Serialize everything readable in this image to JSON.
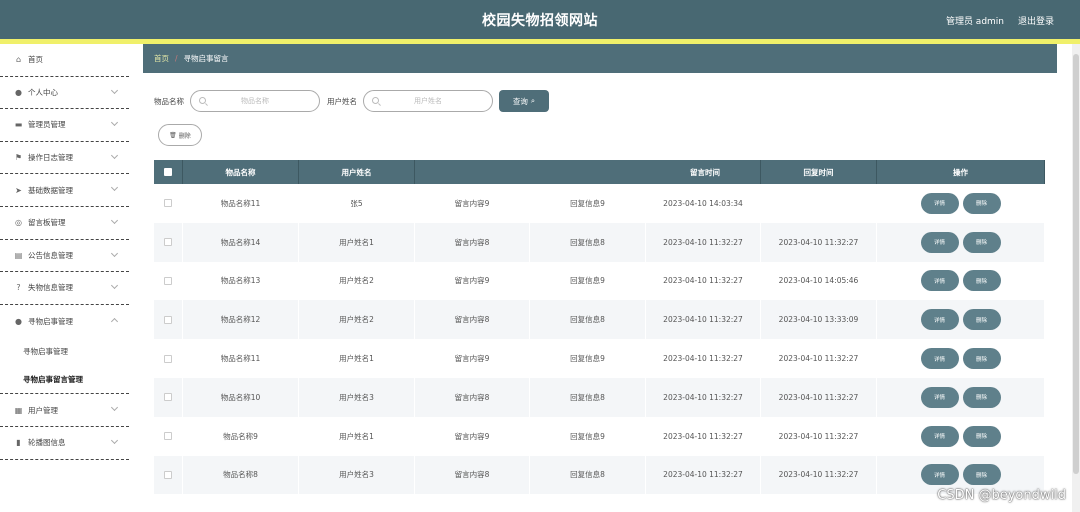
{
  "header": {
    "title": "校园失物招领网站",
    "admin": "管理员 admin",
    "logout": "退出登录"
  },
  "breadcrumb": {
    "home": "首页",
    "sep": "/",
    "current": "寻物启事留言"
  },
  "search": {
    "item_label": "物品名称",
    "item_placeholder": "物品名称",
    "user_label": "用户姓名",
    "user_placeholder": "用户姓名",
    "query_label": "查询"
  },
  "actions": {
    "delete": "删除"
  },
  "sidebar": {
    "items": [
      {
        "label": "首页",
        "icon": "home-icon"
      },
      {
        "label": "个人中心",
        "icon": "user-icon"
      },
      {
        "label": "管理员管理",
        "icon": "monitor-icon"
      },
      {
        "label": "操作日志管理",
        "icon": "flag-icon"
      },
      {
        "label": "基础数据管理",
        "icon": "send-icon"
      },
      {
        "label": "留言板管理",
        "icon": "compass-icon"
      },
      {
        "label": "公告信息管理",
        "icon": "printer-icon"
      },
      {
        "label": "失物信息管理",
        "icon": "question-icon"
      },
      {
        "label": "寻物启事管理",
        "icon": "location-icon"
      },
      {
        "label": "用户管理",
        "icon": "grid-icon"
      },
      {
        "label": "轮播图信息",
        "icon": "bar-chart-icon"
      }
    ],
    "submenu": [
      "寻物启事管理",
      "寻物启事留言管理"
    ]
  },
  "table": {
    "headers": [
      "物品名称",
      "用户姓名",
      "留言时间",
      "回复时间",
      "操作"
    ],
    "detail_label": "详情",
    "delete_label": "删除",
    "rows": [
      {
        "item": "物品名称11",
        "user": "张5",
        "msg": "留言内容9",
        "reply": "回复信息9",
        "msg_time": "2023-04-10 14:03:34",
        "reply_time": ""
      },
      {
        "item": "物品名称14",
        "user": "用户姓名1",
        "msg": "留言内容8",
        "reply": "回复信息8",
        "msg_time": "2023-04-10 11:32:27",
        "reply_time": "2023-04-10 11:32:27"
      },
      {
        "item": "物品名称13",
        "user": "用户姓名2",
        "msg": "留言内容9",
        "reply": "回复信息9",
        "msg_time": "2023-04-10 11:32:27",
        "reply_time": "2023-04-10 14:05:46"
      },
      {
        "item": "物品名称12",
        "user": "用户姓名2",
        "msg": "留言内容8",
        "reply": "回复信息8",
        "msg_time": "2023-04-10 11:32:27",
        "reply_time": "2023-04-10 13:33:09"
      },
      {
        "item": "物品名称11",
        "user": "用户姓名1",
        "msg": "留言内容9",
        "reply": "回复信息9",
        "msg_time": "2023-04-10 11:32:27",
        "reply_time": "2023-04-10 11:32:27"
      },
      {
        "item": "物品名称10",
        "user": "用户姓名3",
        "msg": "留言内容8",
        "reply": "回复信息8",
        "msg_time": "2023-04-10 11:32:27",
        "reply_time": "2023-04-10 11:32:27"
      },
      {
        "item": "物品名称9",
        "user": "用户姓名1",
        "msg": "留言内容9",
        "reply": "回复信息9",
        "msg_time": "2023-04-10 11:32:27",
        "reply_time": "2023-04-10 11:32:27"
      },
      {
        "item": "物品名称8",
        "user": "用户姓名3",
        "msg": "留言内容8",
        "reply": "回复信息8",
        "msg_time": "2023-04-10 11:32:27",
        "reply_time": "2023-04-10 11:32:27"
      }
    ]
  },
  "watermark": "CSDN @beyondwild",
  "colors": {
    "header": "#486872",
    "accent_line": "#f0f06a",
    "primary": "#4f6e79",
    "button": "#5f808b"
  }
}
